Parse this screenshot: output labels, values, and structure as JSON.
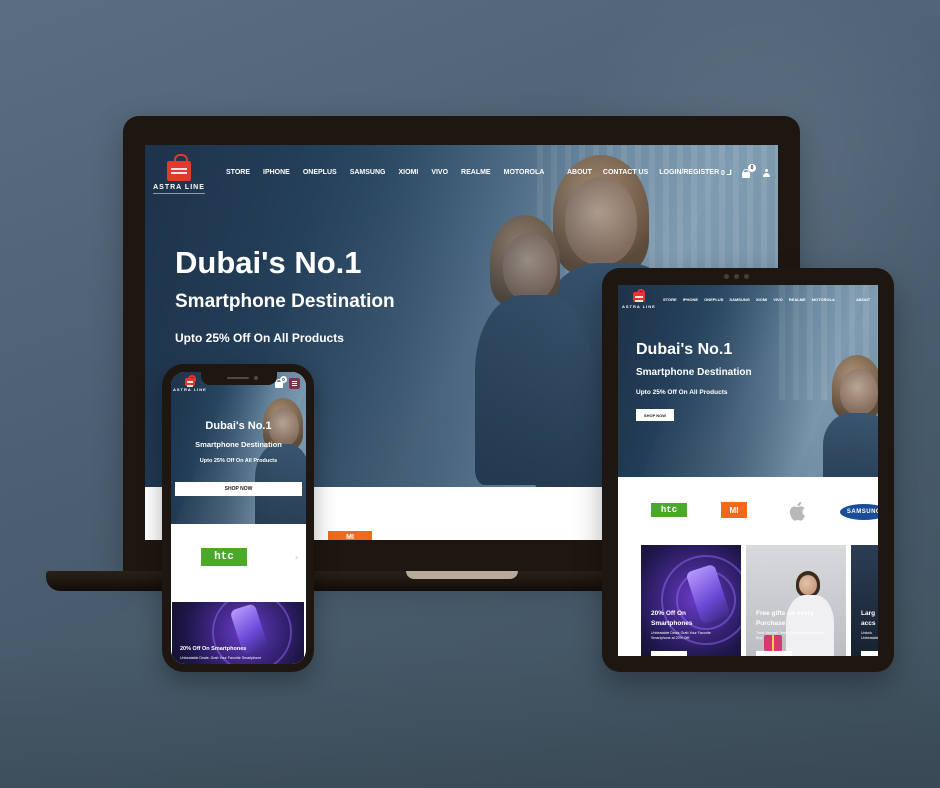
{
  "brand": {
    "name": "ASTRA LINE",
    "accent_color": "#e03a2f",
    "logo_icon": "shopping-bag-icon"
  },
  "nav": {
    "items": [
      "STORE",
      "IPHONE",
      "ONEPLUS",
      "SAMSUNG",
      "XIOMI",
      "VIVO",
      "REALME",
      "MOTOROLA"
    ],
    "secondary": [
      "ABOUT",
      "CONTACT US",
      "LOGIN/REGISTER"
    ],
    "currency_label": "0 لـ",
    "cart_count": "0",
    "cart_icon": "cart-icon",
    "user_icon": "user-icon",
    "menu_icon": "hamburger-menu-icon"
  },
  "hero": {
    "title": "Dubai's No.1",
    "subtitle": "Smartphone Destination",
    "offer": "Upto 25% Off On All Products",
    "cta": "SHOP NOW"
  },
  "brands": {
    "htc": "htc",
    "mi": "MI",
    "apple_icon": "apple-logo-icon",
    "samsung": "SAMSUNG"
  },
  "promos": [
    {
      "title": "20% Off On Smartphones",
      "text": "Unbeatable Deals Grab Your Favorite Smartphone at 20% Off!"
    },
    {
      "title": "Free gifts on every Purchase",
      "text": "Treat Yourself Twice: Free Gifts with Every Buy!"
    },
    {
      "title": "Larg accs",
      "text": "Unlock Unbeatable"
    }
  ],
  "phone_promo": {
    "title": "20% Off On Smartphones",
    "text": "Unbeatable Deals: Grab Your Favorite Smartphone"
  }
}
